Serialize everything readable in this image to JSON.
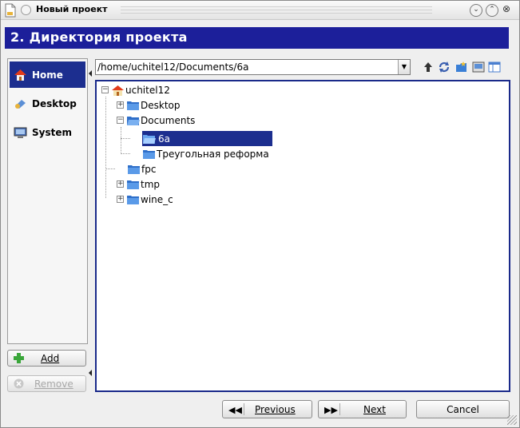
{
  "window": {
    "title": "Новый проект",
    "shade_icon": "chevron-down-icon",
    "maximize_icon": "chevron-up-icon",
    "close_icon": "close-icon"
  },
  "header": {
    "title": "2. Директория проекта"
  },
  "sidebar": {
    "items": [
      {
        "label": "Home",
        "icon": "home-icon"
      },
      {
        "label": "Desktop",
        "icon": "desktop-icon"
      },
      {
        "label": "System",
        "icon": "system-icon"
      }
    ],
    "add_label": "Add",
    "remove_label": "Remove"
  },
  "path": {
    "value": "/home/uchitel12/Documents/6a"
  },
  "tree": {
    "root": "uchitel12",
    "nodes": [
      {
        "label": "Desktop"
      },
      {
        "label": "Documents"
      },
      {
        "label": "6a"
      },
      {
        "label": "Треугольная реформа"
      },
      {
        "label": "fpc"
      },
      {
        "label": "tmp"
      },
      {
        "label": "wine_c"
      }
    ]
  },
  "footer": {
    "previous_label": "Previous",
    "next_label": "Next",
    "cancel_label": "Cancel"
  },
  "colors": {
    "accent": "#1c2e8f",
    "header_band": "#1c1f9a",
    "folder": "#3a7fd6"
  }
}
